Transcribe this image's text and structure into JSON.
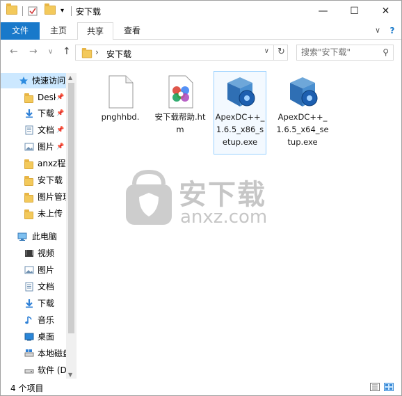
{
  "window": {
    "title": "安下载",
    "min_glyph": "—",
    "max_glyph": "☐",
    "close_glyph": "✕"
  },
  "ribbon": {
    "tabs": [
      {
        "label": "文件"
      },
      {
        "label": "主页"
      },
      {
        "label": "共享"
      },
      {
        "label": "查看"
      }
    ],
    "collapse_glyph": "∨",
    "help_glyph": "?"
  },
  "nav": {
    "back_glyph": "←",
    "forward_glyph": "→",
    "recent_glyph": "∨",
    "up_glyph": "↑",
    "breadcrumb_arrow": "›",
    "breadcrumb": "安下载",
    "dropdown_glyph": "∨",
    "refresh_glyph": "↻",
    "search_placeholder": "搜索\"安下载\"",
    "search_glyph": "⚲"
  },
  "sidebar": {
    "quick_access": {
      "label": "快速访问"
    },
    "pinned": [
      {
        "label": "Desk",
        "icon": "folder-icon"
      },
      {
        "label": "下载",
        "icon": "download-icon"
      },
      {
        "label": "文档",
        "icon": "document-icon"
      },
      {
        "label": "图片",
        "icon": "picture-icon"
      }
    ],
    "recent": [
      {
        "label": "anxz程序",
        "icon": "folder-icon"
      },
      {
        "label": "安下载",
        "icon": "folder-icon"
      },
      {
        "label": "图片管理",
        "icon": "folder-icon"
      },
      {
        "label": "未上传",
        "icon": "folder-icon"
      }
    ],
    "this_pc": {
      "label": "此电脑"
    },
    "pc_items": [
      {
        "label": "视频",
        "icon": "video-icon"
      },
      {
        "label": "图片",
        "icon": "picture-icon"
      },
      {
        "label": "文档",
        "icon": "document-icon"
      },
      {
        "label": "下载",
        "icon": "download-icon"
      },
      {
        "label": "音乐",
        "icon": "music-icon"
      },
      {
        "label": "桌面",
        "icon": "desktop-icon"
      },
      {
        "label": "本地磁盘",
        "icon": "drive-icon"
      },
      {
        "label": "软件 (D",
        "icon": "drive-icon"
      }
    ]
  },
  "files": [
    {
      "name": "pnghhbd.",
      "icon": "blank-file-icon"
    },
    {
      "name": "安下载帮助.htm",
      "icon": "htm-file-icon"
    },
    {
      "name": "ApexDC++_1.6.5_x86_setup.exe",
      "icon": "installer-icon"
    },
    {
      "name": "ApexDC++_1.6.5_x64_setup.exe",
      "icon": "installer-icon"
    }
  ],
  "watermark": {
    "brand": "安下载",
    "domain": "anxz.com"
  },
  "status": {
    "item_count": "4 个项目"
  },
  "colors": {
    "accent": "#1979ca",
    "selection": "#cce8ff",
    "folder": "#f3c95b"
  }
}
